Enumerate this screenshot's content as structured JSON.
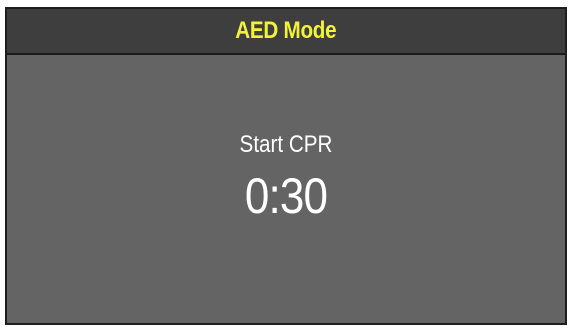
{
  "header": {
    "title": "AED Mode",
    "title_color": "#f2f23c",
    "background": "#3e3e3e"
  },
  "main": {
    "instruction": "Start CPR",
    "timer": "0:30",
    "background": "#646464"
  }
}
